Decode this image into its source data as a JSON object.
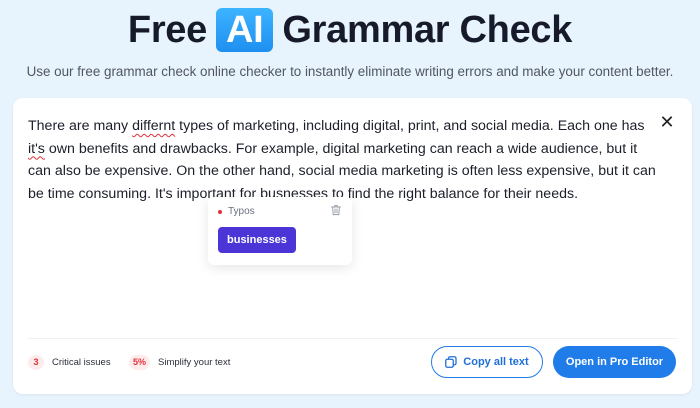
{
  "hero": {
    "title_before": "Free",
    "title_badge": "AI",
    "title_after": "Grammar Check",
    "subtitle": "Use our free grammar check online checker to instantly eliminate writing errors and make your content better."
  },
  "editor": {
    "segments": [
      {
        "text": "There are many ",
        "error": false
      },
      {
        "text": "differnt",
        "error": true
      },
      {
        "text": " types of marketing, including digital, print, and social media. Each one has ",
        "error": false
      },
      {
        "text": "it's",
        "error": true
      },
      {
        "text": " own benefits and drawbacks. For example, digital marketing can reach a wide audience, but it can also be expensive. On the other hand, social media marketing is often less expensive, but it can be time consuming. It's important for ",
        "error": false
      },
      {
        "text": "busnesses",
        "error": true
      },
      {
        "text": " to find the right balance for their needs.",
        "error": false
      }
    ],
    "close_icon": "close-icon"
  },
  "popup": {
    "category": "Typos",
    "suggestion": "businesses",
    "delete_icon": "trash-icon"
  },
  "footer": {
    "critical_count": "3",
    "critical_label": "Critical issues",
    "simplify_pct": "5%",
    "simplify_label": "Simplify your text",
    "copy_label": "Copy all text",
    "pro_label": "Open in Pro Editor"
  },
  "colors": {
    "background": "#e8f4fd",
    "accent": "#1f7ce8",
    "badge": "#2aa3f8",
    "error": "#e2303a",
    "suggestion": "#4b35d6"
  }
}
